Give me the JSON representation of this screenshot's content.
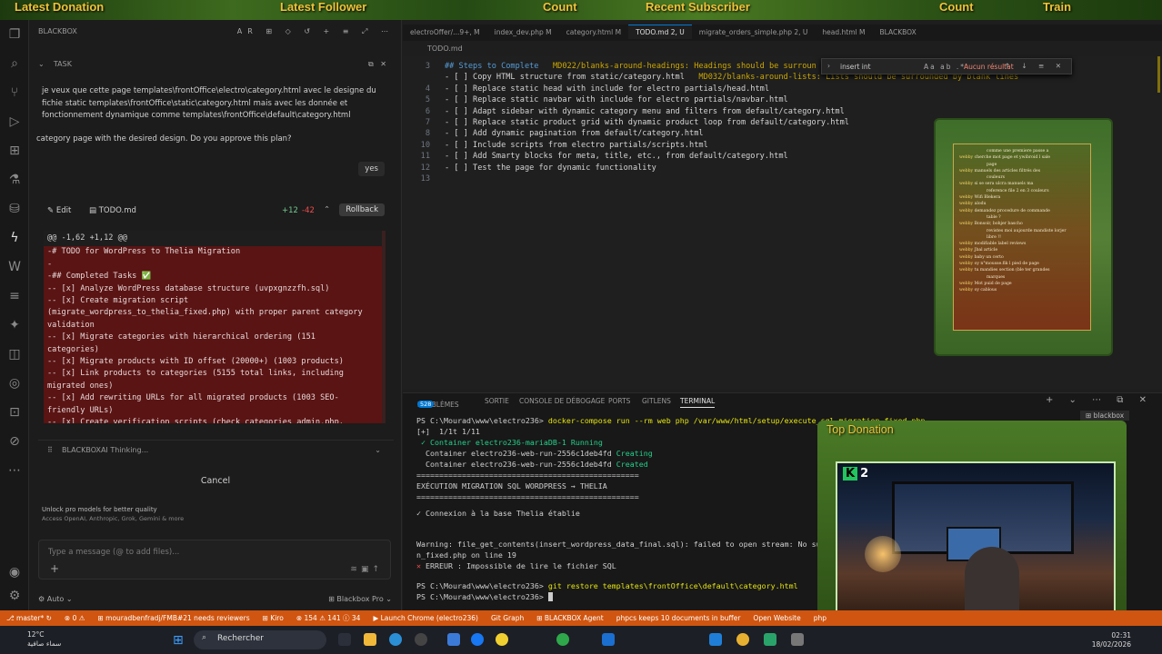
{
  "stream_bar": {
    "labels": [
      "Latest Donation",
      "Latest Follower",
      "Count",
      "Recent Subscriber",
      "Count",
      "Train"
    ]
  },
  "chat": {
    "header_title": "BLACKBOX",
    "header_tools": "AR ⊞ ◇ ↺ + ≡ ⤢ ⋯",
    "task_label": "TASK",
    "task_text": "je veux que cette page templates\\frontOffice\\electro\\category.html avec le designe du fichie static templates\\frontOffice\\static\\category.html mais avec les donnée et fonctionnement dynamique comme templates\\frontOffice\\default\\category.html",
    "plan_text": "category page with the desired design. Do you approve this plan?",
    "yes": "yes",
    "edit_label": "Edit",
    "edit_file": "TODO.md",
    "additions": "+12",
    "deletions": "-42",
    "rollback": "Rollback",
    "diff_lines": [
      "@@ -1,62 +1,12 @@",
      "-# TODO for WordPress to Thelia Migration",
      "-",
      "-## Completed Tasks ✅",
      "-- [x] Analyze WordPress database structure (uvpxgnzzfh.sql)",
      "-- [x] Create migration script",
      "(migrate_wordpress_to_thelia_fixed.php) with proper parent category",
      "validation",
      "-- [x] Migrate categories with hierarchical ordering (151",
      "categories)",
      "-- [x] Migrate products with ID offset (20000+) (1003 products)",
      "-- [x] Link products to categories (5155 total links, including",
      "migrated ones)",
      "-- [x] Add rewriting URLs for all migrated products (1003 SEO-",
      "friendly URLs)",
      "-- [x] Create verification scripts (check_categories_admin.php,"
    ],
    "thinking": "BLACKBOXAI Thinking...",
    "cancel": "Cancel",
    "unlock_title": "Unlock pro models for better quality",
    "unlock_sub": "Access OpenAI, Anthropic, Grok, Gemini & more",
    "input_placeholder": "Type a message (@ to add files)...",
    "footer_left": "Auto ⌄",
    "footer_right": "Blackbox Pro ⌄"
  },
  "editor": {
    "tabs": [
      {
        "label": "electroOffer/...9+, M",
        "active": false
      },
      {
        "label": "index_dev.php M",
        "active": false
      },
      {
        "label": "category.html M",
        "active": false
      },
      {
        "label": "TODO.md 2, U",
        "active": true
      },
      {
        "label": "migrate_orders_simple.php 2, U",
        "active": false
      },
      {
        "label": "head.html M",
        "active": false
      },
      {
        "label": "BLACKBOX",
        "active": false
      }
    ],
    "breadcrumb": "TODO.md",
    "lines": [
      {
        "n": "3",
        "text": "## Steps to Complete",
        "lint": "   MD022/blanks-around-headings: Headings should be surroun"
      },
      {
        "n": "",
        "text": "- [ ] Copy HTML structure from static/category.html",
        "lint": "   MD032/blanks-around-lists: Lists should be surrounded by blank lines"
      },
      {
        "n": "4",
        "text": "- [ ] Replace static head with include for electro partials/head.html",
        "lint": ""
      },
      {
        "n": "5",
        "text": "- [ ] Replace static navbar with include for electro partials/navbar.html",
        "lint": ""
      },
      {
        "n": "6",
        "text": "- [ ] Adapt sidebar with dynamic category menu and filters from default/category.html",
        "lint": ""
      },
      {
        "n": "7",
        "text": "- [ ] Replace static product grid with dynamic product loop from default/category.html",
        "lint": ""
      },
      {
        "n": "8",
        "text": "- [ ] Add dynamic pagination from default/category.html",
        "lint": ""
      },
      {
        "n": "10",
        "text": "- [ ] Include scripts from electro partials/scripts.html",
        "lint": ""
      },
      {
        "n": "11",
        "text": "- [ ] Add Smarty blocks for meta, title, etc., from default/category.html",
        "lint": ""
      },
      {
        "n": "12",
        "text": "- [ ] Test the page for dynamic functionality",
        "lint": ""
      },
      {
        "n": "13",
        "text": "",
        "lint": ""
      }
    ],
    "find_query": "insert int",
    "find_options": "Aa ab .*",
    "find_result": "Aucun résultat",
    "find_controls": "↑ ↓ ≡ ✕"
  },
  "overlay_card": {
    "entries": [
      {
        "user": "",
        "msg": "comme une premiere passe a"
      },
      {
        "user": "webby",
        "msg": "cherche mot page et ywibroid l sale"
      },
      {
        "user": "",
        "msg": "page"
      },
      {
        "user": "webby",
        "msg": "manuels des articles filtrés des"
      },
      {
        "user": "",
        "msg": "couleurs"
      },
      {
        "user": "webby",
        "msg": "si se sera ulcra manuels ma"
      },
      {
        "user": "",
        "msg": "reference file 2 en 3 couleurs"
      },
      {
        "user": "webby",
        "msg": "Wifi Blekera"
      },
      {
        "user": "webby",
        "msg": "alodu"
      },
      {
        "user": "webby",
        "msg": "demandez procedure de commande"
      },
      {
        "user": "",
        "msg": "table ?"
      },
      {
        "user": "webby",
        "msg": "Bonsoir, bohjer bascho"
      },
      {
        "user": "",
        "msg": "revistes moi aujourde mandiste lorjer"
      },
      {
        "user": "",
        "msg": "libre !!"
      },
      {
        "user": "webby",
        "msg": "modifiable label reviews"
      },
      {
        "user": "webby",
        "msg": "Jbal article"
      },
      {
        "user": "webby",
        "msg": "baby un certo"
      },
      {
        "user": "webby",
        "msg": "oy n°mousse.fik l pied de page"
      },
      {
        "user": "webby",
        "msg": "tu mandies section (ble ter grandes"
      },
      {
        "user": "",
        "msg": "marques"
      },
      {
        "user": "webby",
        "msg": "Mot puid de page"
      },
      {
        "user": "webby",
        "msg": "oy cablous"
      }
    ]
  },
  "panel": {
    "tabs": [
      {
        "label": "PROBLÈMES",
        "badge": "528"
      },
      {
        "label": "SORTIE",
        "badge": ""
      },
      {
        "label": "CONSOLE DE DÉBOGAGE",
        "badge": ""
      },
      {
        "label": "PORTS",
        "badge": ""
      },
      {
        "label": "GITLENS",
        "badge": ""
      },
      {
        "label": "TERMINAL",
        "badge": "",
        "active": true
      }
    ],
    "right_icons": "+ ⌄ ⋯ ⧉ ✕",
    "terminal_badge": "blackbox"
  },
  "terminal": {
    "prompt1": "PS C:\\Mourad\\www\\electro236> ",
    "cmd1": "docker-compose run --rm web php /var/www/html/setup/execute_sql_migration_fixed.php",
    "l2": "[+]  1/1t 1/11",
    "l3a": " ✓ Container electro236-mariaDB-1 ",
    "l3b": "Running",
    "l4a": "  Container electro236-web-run-2556c1deb4fd ",
    "l4b": "Creating",
    "l5a": "  Container electro236-web-run-2556c1deb4fd ",
    "l5b": "Created",
    "l6": "=================================================",
    "l7": "EXÉCUTION MIGRATION SQL WORDPRESS → THELIA",
    "l8": "=================================================",
    "l9": "✓ Connexion à la base Thelia établie",
    "l10": "Warning: file_get_contents(insert_wordpress_data_final.sql): failed to open stream: No such fi",
    "l11": "n_fixed.php on line 19",
    "l12a": "✕ ",
    "l12b": "ERREUR : Impossible de lire le fichier SQL",
    "prompt2": "PS C:\\Mourad\\www\\electro236> ",
    "cmd2": "git restore templates\\frontOffice\\default\\category.html",
    "prompt3": "PS C:\\Mourad\\www\\electro236> "
  },
  "webcam": {
    "title": "Top Donation",
    "count": "2"
  },
  "status_bar": {
    "items": [
      "⎇ master* ↻",
      "⊗ 0 ⚠",
      "⊞ mouradbenfradj/FMB#21 needs reviewers",
      "⊞ Kiro",
      "⊗ 154 ⚠ 141 ⓘ 34",
      "▶ Launch Chrome (electro236)",
      "Git Graph",
      "⊞ BLACKBOX Agent",
      "phpcs keeps 10 documents in buffer",
      "Open Website",
      "php"
    ]
  },
  "taskbar": {
    "temp": "12°C",
    "weather_desc": "سماء صافية",
    "search": "Rechercher",
    "time": "02:31",
    "date": "18/02/2026"
  }
}
